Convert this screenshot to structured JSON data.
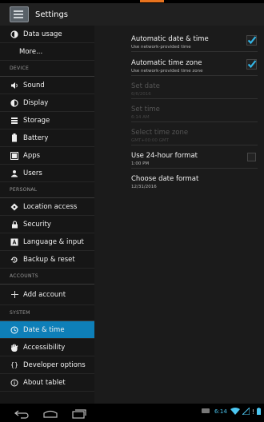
{
  "app": {
    "title": "Settings",
    "icon": "settings-app-icon"
  },
  "sidebar": {
    "top_items": [
      {
        "label": "Data usage",
        "icon": "data-usage-icon"
      },
      {
        "label": "More...",
        "icon": ""
      }
    ],
    "sections": [
      {
        "header": "DEVICE",
        "items": [
          {
            "label": "Sound",
            "icon": "sound-icon"
          },
          {
            "label": "Display",
            "icon": "display-icon"
          },
          {
            "label": "Storage",
            "icon": "storage-icon"
          },
          {
            "label": "Battery",
            "icon": "battery-icon"
          },
          {
            "label": "Apps",
            "icon": "apps-icon"
          },
          {
            "label": "Users",
            "icon": "users-icon"
          }
        ]
      },
      {
        "header": "PERSONAL",
        "items": [
          {
            "label": "Location access",
            "icon": "location-icon"
          },
          {
            "label": "Security",
            "icon": "lock-icon"
          },
          {
            "label": "Language & input",
            "icon": "language-icon"
          },
          {
            "label": "Backup & reset",
            "icon": "backup-icon"
          }
        ]
      },
      {
        "header": "ACCOUNTS",
        "items": [
          {
            "label": "Add account",
            "icon": "plus-icon"
          }
        ]
      },
      {
        "header": "SYSTEM",
        "items": [
          {
            "label": "Date & time",
            "icon": "clock-icon",
            "active": true
          },
          {
            "label": "Accessibility",
            "icon": "hand-icon"
          },
          {
            "label": "Developer options",
            "icon": "braces-icon"
          },
          {
            "label": "About tablet",
            "icon": "info-icon"
          }
        ]
      }
    ]
  },
  "content": {
    "rows": [
      {
        "title": "Automatic date & time",
        "summary": "Use network-provided time",
        "checkbox": "checked",
        "enabled": true
      },
      {
        "title": "Automatic time zone",
        "summary": "Use network-provided time zone",
        "checkbox": "checked",
        "enabled": true
      },
      {
        "title": "Set date",
        "summary": "6/6/2016",
        "checkbox": "none",
        "enabled": false
      },
      {
        "title": "Set time",
        "summary": "6:14 AM",
        "checkbox": "none",
        "enabled": false
      },
      {
        "title": "Select time zone",
        "summary": "GMT+00:00 GMT",
        "checkbox": "none",
        "enabled": false
      },
      {
        "title": "Use 24-hour format",
        "summary": "1:00 PM",
        "checkbox": "unchecked",
        "enabled": true
      },
      {
        "title": "Choose date format",
        "summary": "12/31/2016",
        "checkbox": "none",
        "enabled": true
      }
    ]
  },
  "navbar": {
    "time": "6:14",
    "buttons": [
      "back-icon",
      "home-icon",
      "recents-icon"
    ]
  },
  "colors": {
    "accent": "#0e7fb8",
    "check": "#33b5e5",
    "status_accent": "#e8731e"
  }
}
